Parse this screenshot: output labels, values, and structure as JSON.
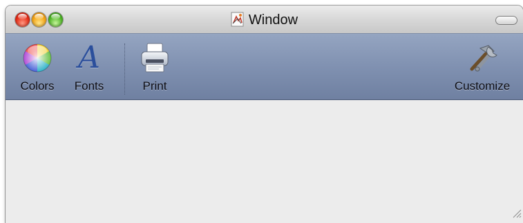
{
  "window": {
    "title": "Window",
    "title_icon": "document-icon"
  },
  "toolbar": {
    "items": [
      {
        "label": "Colors",
        "icon": "color-wheel-icon"
      },
      {
        "label": "Fonts",
        "icon": "font-icon"
      },
      {
        "label": "Print",
        "icon": "printer-icon"
      },
      {
        "label": "Customize",
        "icon": "hammer-wrench-icon"
      }
    ],
    "fonts_glyph": "A"
  },
  "colors": {
    "toolbar_top": "#95a5c1",
    "toolbar_bottom": "#6f80a1",
    "content_background": "#ececec",
    "close_button": "#e52a14",
    "minimize_button": "#f4a414",
    "zoom_button": "#4fb526"
  }
}
